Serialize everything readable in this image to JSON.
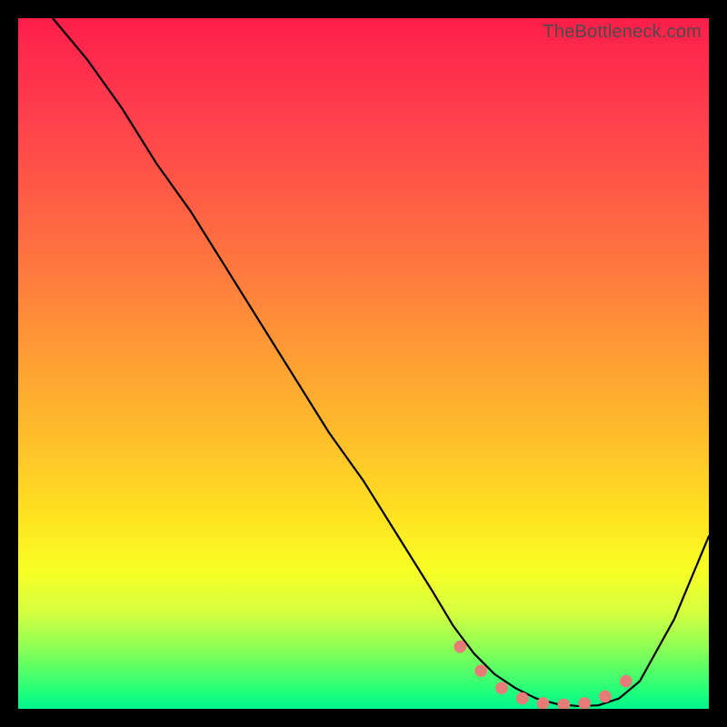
{
  "watermark": "TheBottleneck.com",
  "chart_data": {
    "type": "line",
    "title": "",
    "xlabel": "",
    "ylabel": "",
    "xlim": [
      0,
      100
    ],
    "ylim": [
      0,
      100
    ],
    "grid": false,
    "series": [
      {
        "name": "curve",
        "color": "#000000",
        "x": [
          5,
          10,
          15,
          20,
          25,
          30,
          35,
          40,
          45,
          50,
          55,
          60,
          63,
          66,
          69,
          72,
          75,
          78,
          81,
          84,
          87,
          90,
          95,
          100
        ],
        "y": [
          100,
          94,
          87,
          79,
          72,
          64,
          56,
          48,
          40,
          33,
          25,
          17,
          12,
          8,
          5,
          3,
          1.5,
          0.7,
          0.4,
          0.5,
          1.5,
          4,
          13,
          25
        ]
      }
    ],
    "markers": {
      "name": "salmon-dots",
      "color": "#e77b78",
      "radius_pct": 0.9,
      "x": [
        64,
        67,
        70,
        73,
        76,
        79,
        82,
        85,
        88
      ],
      "y": [
        9,
        5.5,
        3,
        1.5,
        0.8,
        0.6,
        0.8,
        1.8,
        4
      ]
    }
  }
}
